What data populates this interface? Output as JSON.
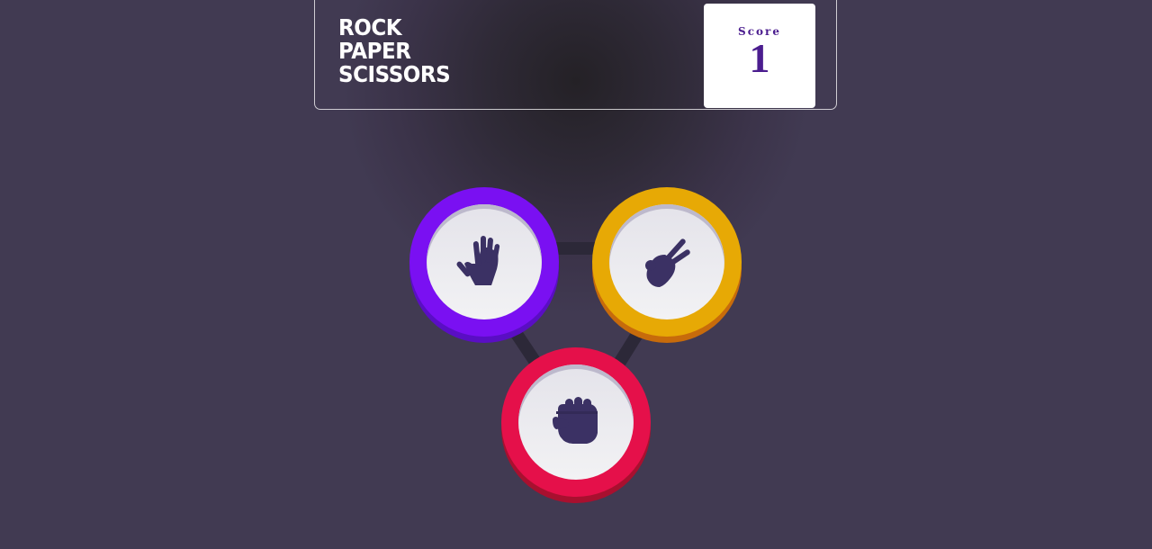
{
  "header": {
    "title_lines": [
      "ROCK",
      "PAPER",
      "SCISSORS"
    ],
    "score_label": "Score",
    "score_value": "1"
  },
  "choices": [
    {
      "id": "paper",
      "icon": "hand-paper-icon",
      "color": "#7a10f2"
    },
    {
      "id": "scissors",
      "icon": "hand-scissors-icon",
      "color": "#e7a905"
    },
    {
      "id": "rock",
      "icon": "hand-rock-icon",
      "color": "#e5104a"
    }
  ],
  "colors": {
    "background": "#413a52",
    "icon": "#3b3164",
    "score_text": "#4b1d8f"
  }
}
